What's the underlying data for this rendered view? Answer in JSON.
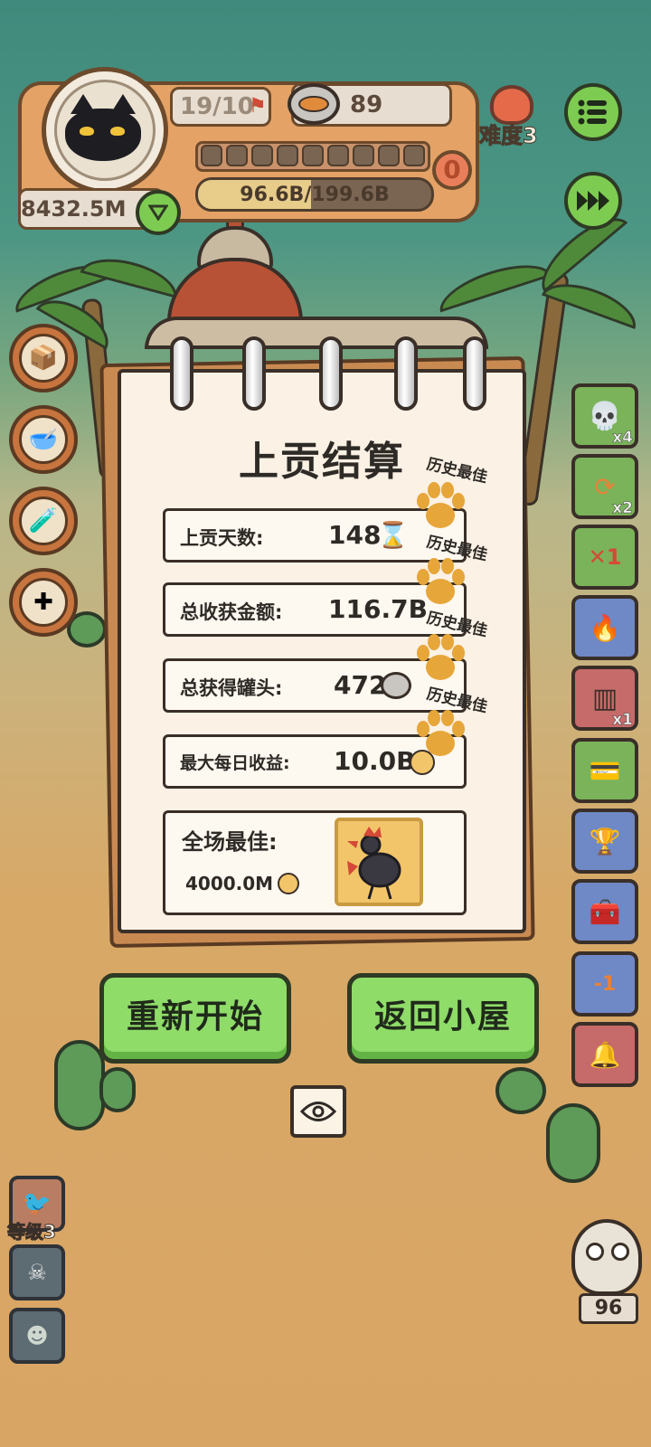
{
  "hud": {
    "stage_progress": "19/10",
    "cans": "89",
    "money": "8432.5M",
    "tribute_progress": "96.6B/199.6B",
    "badge_count": "0",
    "difficulty": "难度3"
  },
  "side_buttons_right": {
    "skull_mult": "x4",
    "swap_mult": "x2",
    "cage_mult": "x1"
  },
  "summary": {
    "title": "上贡结算",
    "best_tag": "历史最佳",
    "rows": [
      {
        "label": "上贡天数:",
        "value": "148"
      },
      {
        "label": "总收获金额:",
        "value": "116.7B"
      },
      {
        "label": "总获得罐头:",
        "value": "472"
      },
      {
        "label": "最大每日收益:",
        "value": "10.0B"
      }
    ],
    "best_overall": {
      "label": "全场最佳:",
      "value": "4000.0M"
    }
  },
  "buttons": {
    "restart": "重新开始",
    "return_home": "返回小屋"
  },
  "bottom_left": {
    "level": "等级3"
  },
  "bottom_right": {
    "count": "96"
  },
  "colors": {
    "accent_green": "#8fdc69",
    "paw_orange": "#e7a63a",
    "paper": "#fbf1e4",
    "hud_orange": "#e4a266"
  }
}
